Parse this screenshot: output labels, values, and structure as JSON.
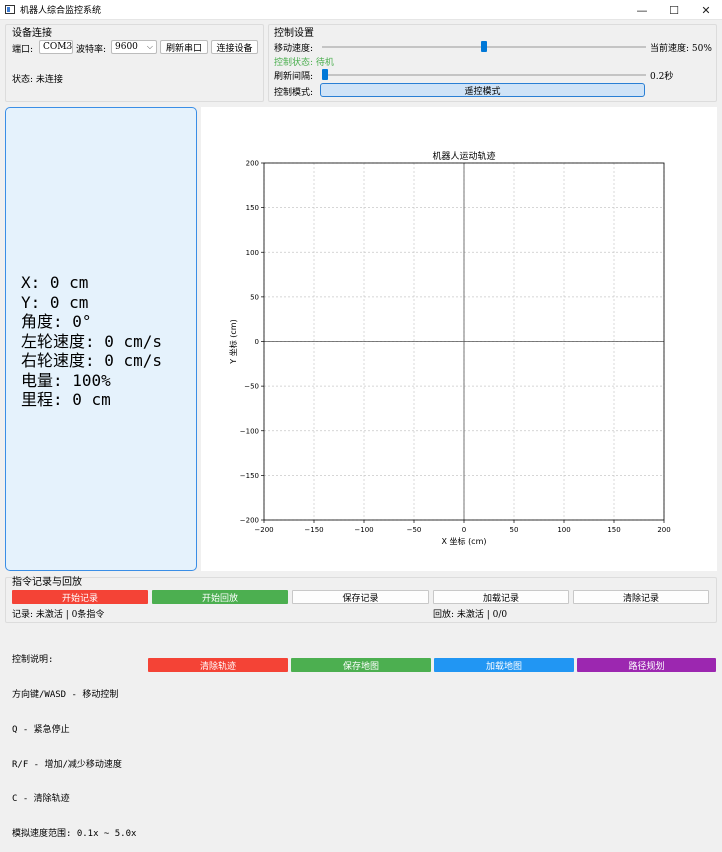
{
  "window": {
    "title": "机器人综合监控系统",
    "controls": {
      "minimize": "—",
      "maximize": "☐",
      "close": "✕"
    }
  },
  "device": {
    "group_title": "设备连接",
    "port_label": "端口:",
    "port_value": "COM3",
    "baud_label": "波特率:",
    "baud_value": "9600",
    "refresh_ports": "刷新串口",
    "connect": "连接设备",
    "status": "状态: 未连接"
  },
  "control": {
    "group_title": "控制设置",
    "speed_label": "移动速度:",
    "speed_percent": 50,
    "speed_readout": "当前速度: 50%",
    "state_text": "控制状态: 待机",
    "interval_label": "刷新间隔:",
    "interval_fraction": 0,
    "interval_readout": "0.2秒",
    "mode_label": "控制模式:",
    "mode_button": "遥控模式"
  },
  "status_panel": {
    "x": "X: 0 cm",
    "y": "Y: 0 cm",
    "angle": "角度: 0°",
    "left_speed": "左轮速度: 0 cm/s",
    "right_speed": "右轮速度: 0 cm/s",
    "battery": "电量: 100%",
    "mileage": "里程: 0 cm"
  },
  "chart_data": {
    "type": "line",
    "title": "机器人运动轨迹",
    "xlabel": "X 坐标 (cm)",
    "ylabel": "Y 坐标 (cm)",
    "xlim": [
      -200,
      200
    ],
    "ylim": [
      -200,
      200
    ],
    "xticks": [
      -200,
      -150,
      -100,
      -50,
      0,
      50,
      100,
      150,
      200
    ],
    "yticks": [
      -200,
      -150,
      -100,
      -50,
      0,
      50,
      100,
      150,
      200
    ],
    "grid": true,
    "series": []
  },
  "record": {
    "group_title": "指令记录与回放",
    "start_record": "开始记录",
    "start_playback": "开始回放",
    "save_record": "保存记录",
    "load_record": "加载记录",
    "clear_record": "清除记录",
    "record_status": "记录: 未激活 | 0条指令",
    "playback_status": "回放: 未激活 | 0/0"
  },
  "help": {
    "lines": [
      "控制说明:",
      "方向键/WASD - 移动控制",
      "Q - 紧急停止",
      "R/F - 增加/减少移动速度",
      "C - 清除轨迹",
      "模拟速度范围: 0.1x ~ 5.0x"
    ]
  },
  "bottom_buttons": {
    "clear_track": "清除轨迹",
    "save_map": "保存地图",
    "load_map": "加载地图",
    "path_plan": "路径规划"
  },
  "colors": {
    "red": "#f44336",
    "green": "#4caf50",
    "blue": "#2196f3",
    "purple": "#9c27b0",
    "accent": "#0078d7",
    "state_green": "#4caf50"
  }
}
